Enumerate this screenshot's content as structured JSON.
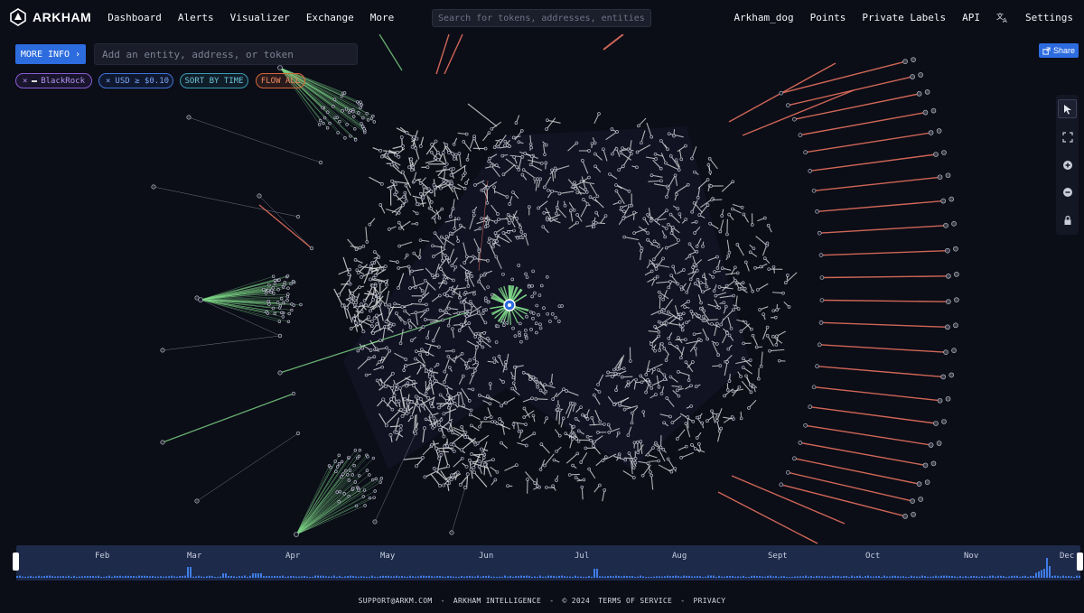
{
  "brand": {
    "name": "ARKHAM"
  },
  "nav": {
    "dashboard": "Dashboard",
    "alerts": "Alerts",
    "visualizer": "Visualizer",
    "exchange": "Exchange",
    "more": "More",
    "search_placeholder": "Search for tokens, addresses, entities...",
    "user": "Arkham_dog",
    "points": "Points",
    "private_labels": "Private Labels",
    "api": "API",
    "settings": "Settings"
  },
  "toolbar": {
    "more_info": "MORE INFO",
    "entity_placeholder": "Add an entity, address, or token",
    "chips": {
      "blackrock": "BlackRock",
      "usd": "USD ≥ $0.10",
      "sort": "SORT BY TIME",
      "flow": "FLOW ALL"
    },
    "share": "Share"
  },
  "timeline": {
    "months": [
      "Feb",
      "Mar",
      "Apr",
      "May",
      "Jun",
      "Jul",
      "Aug",
      "Sept",
      "Oct",
      "Nov",
      "Dec"
    ]
  },
  "footer": {
    "support": "SUPPORT@ARKM.COM",
    "company": "ARKHAM INTELLIGENCE",
    "copyright": "© 2024",
    "tos": "TERMS OF SERVICE",
    "privacy": "PRIVACY",
    "sep": "-"
  },
  "colors": {
    "background": "#0b0d17",
    "accent": "#2d6cdf",
    "inflow": "#7ed787",
    "outflow": "#e4705d",
    "edge": "#d8d8d8"
  }
}
